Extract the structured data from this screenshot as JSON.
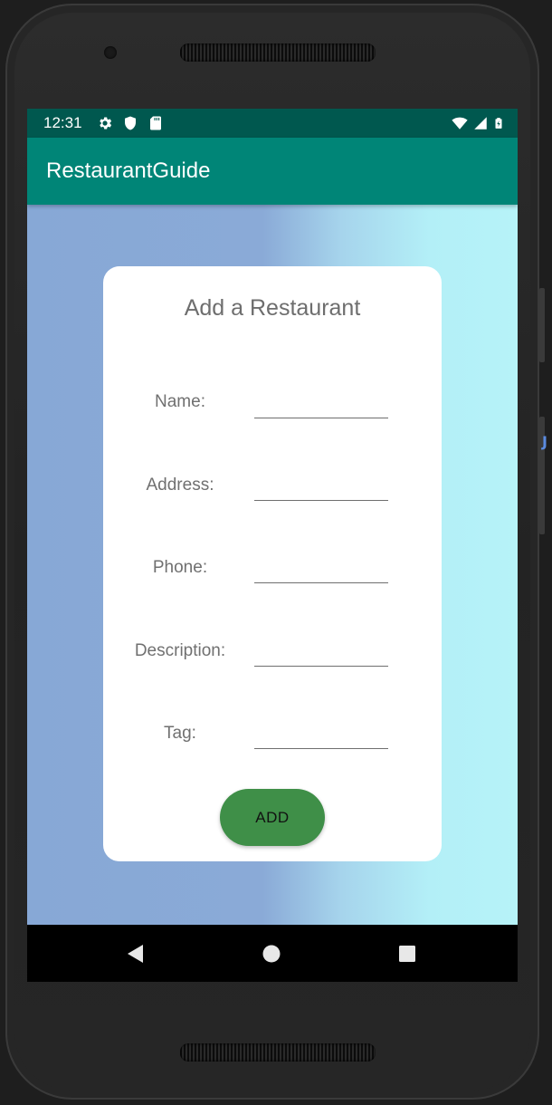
{
  "status_bar": {
    "time": "12:31",
    "left_icons": [
      "gear-icon",
      "shield-icon",
      "sd-card-icon"
    ],
    "right_icons": [
      "wifi-icon",
      "signal-icon",
      "battery-icon"
    ]
  },
  "app_bar": {
    "title": "RestaurantGuide"
  },
  "form": {
    "title": "Add a Restaurant",
    "fields": [
      {
        "label": "Name:",
        "value": ""
      },
      {
        "label": "Address:",
        "value": ""
      },
      {
        "label": "Phone:",
        "value": ""
      },
      {
        "label": "Description:",
        "value": ""
      },
      {
        "label": "Tag:",
        "value": ""
      }
    ],
    "add_button_label": "ADD"
  },
  "nav_bar": {
    "buttons": [
      "back-icon",
      "home-icon",
      "recents-icon"
    ]
  },
  "colors": {
    "status_bar": "#00584f",
    "app_bar": "#008577",
    "button": "#3f8f48"
  }
}
